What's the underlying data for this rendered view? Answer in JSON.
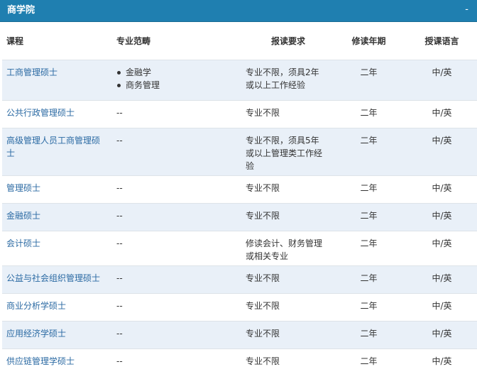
{
  "header": {
    "title": "商学院",
    "collapse_symbol": "-"
  },
  "table": {
    "columns": [
      "课程",
      "专业范畴",
      "报读要求",
      "修读年期",
      "授课语言"
    ],
    "rows": [
      {
        "course": "工商管理硕士",
        "field": [
          "金融学",
          "商务管理"
        ],
        "requirement": "专业不限，须具2年或以上工作经验",
        "duration": "二年",
        "language": "中/英"
      },
      {
        "course": "公共行政管理硕士",
        "field": [
          "--"
        ],
        "requirement": "专业不限",
        "duration": "二年",
        "language": "中/英"
      },
      {
        "course": "高级管理人员工商管理硕士",
        "field": [
          "--"
        ],
        "requirement": "专业不限，须具5年或以上管理类工作经验",
        "duration": "二年",
        "language": "中/英"
      },
      {
        "course": "管理硕士",
        "field": [
          "--"
        ],
        "requirement": "专业不限",
        "duration": "二年",
        "language": "中/英"
      },
      {
        "course": "金融硕士",
        "field": [
          "--"
        ],
        "requirement": "专业不限",
        "duration": "二年",
        "language": "中/英"
      },
      {
        "course": "会计硕士",
        "field": [
          "--"
        ],
        "requirement": "修读会计、财务管理或相关专业",
        "duration": "二年",
        "language": "中/英"
      },
      {
        "course": "公益与社会组织管理硕士",
        "field": [
          "--"
        ],
        "requirement": "专业不限",
        "duration": "二年",
        "language": "中/英"
      },
      {
        "course": "商业分析学硕士",
        "field": [
          "--"
        ],
        "requirement": "专业不限",
        "duration": "二年",
        "language": "中/英"
      },
      {
        "course": "应用经济学硕士",
        "field": [
          "--"
        ],
        "requirement": "专业不限",
        "duration": "二年",
        "language": "中/英"
      },
      {
        "course": "供应链管理学硕士",
        "field": [
          "--"
        ],
        "requirement": "专业不限",
        "duration": "二年",
        "language": "中/英"
      }
    ]
  },
  "colors": {
    "header_bg": "#1f7fb0",
    "link": "#2b6aa3",
    "row_alt_bg": "#e9f0f8"
  }
}
